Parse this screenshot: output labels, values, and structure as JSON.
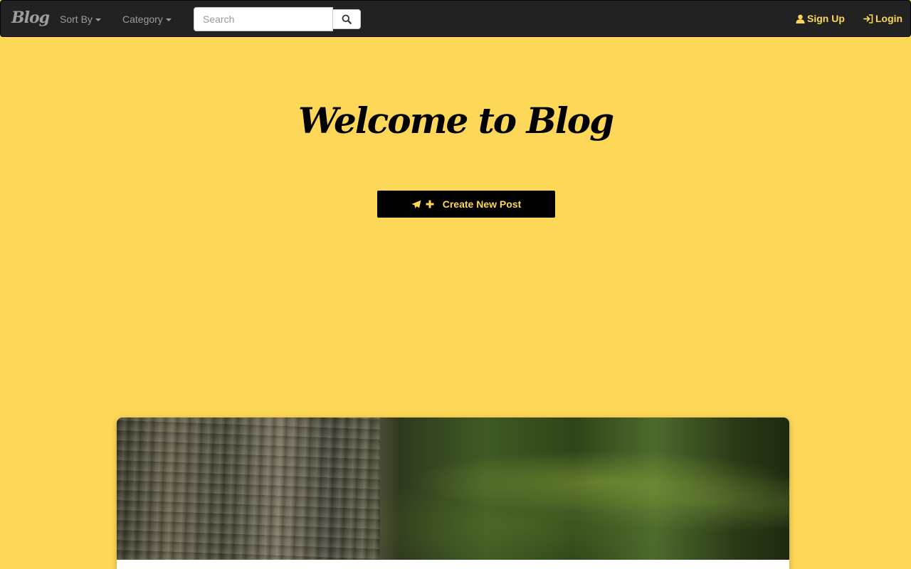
{
  "navbar": {
    "brand": "Blog",
    "sort_label": "Sort By",
    "category_label": "Category",
    "search_placeholder": "Search",
    "signup_label": "Sign Up",
    "login_label": "Login",
    "icons": {
      "search": "search-icon",
      "signup": "user-icon",
      "login": "login-icon"
    }
  },
  "hero": {
    "title": "Welcome to Blog",
    "create_label": "Create New Post",
    "icons": [
      "paper-plane-icon",
      "plus-icon"
    ]
  },
  "colors": {
    "background": "#fdd757",
    "navbar": "#222222",
    "accent": "#fdd757",
    "button": "#000000"
  }
}
